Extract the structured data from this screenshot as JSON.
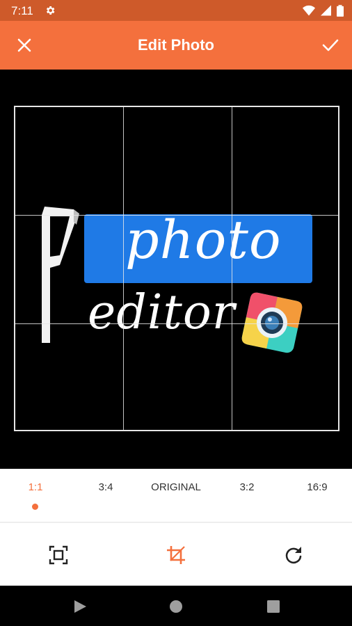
{
  "status_bar": {
    "time": "7:11",
    "icons": [
      "gear-icon",
      "wifi-icon",
      "signal-icon",
      "battery-icon"
    ]
  },
  "app_bar": {
    "title": "Edit Photo",
    "close_icon": "close-icon",
    "confirm_icon": "check-icon",
    "color": "#f4703d"
  },
  "image": {
    "logo_word_1": "photo",
    "logo_word_2": "editor",
    "accent_blue": "#1f7ae6"
  },
  "aspect_ratios": {
    "items": [
      {
        "label": "1:1",
        "selected": true
      },
      {
        "label": "3:4",
        "selected": false
      },
      {
        "label": "ORIGINAL",
        "selected": false
      },
      {
        "label": "3:2",
        "selected": false
      },
      {
        "label": "16:9",
        "selected": false
      }
    ]
  },
  "tools": [
    {
      "name": "fit-frame-icon",
      "active": false
    },
    {
      "name": "crop-icon",
      "active": true
    },
    {
      "name": "rotate-icon",
      "active": false
    }
  ],
  "nav": [
    "back-icon",
    "home-icon",
    "recents-icon"
  ]
}
